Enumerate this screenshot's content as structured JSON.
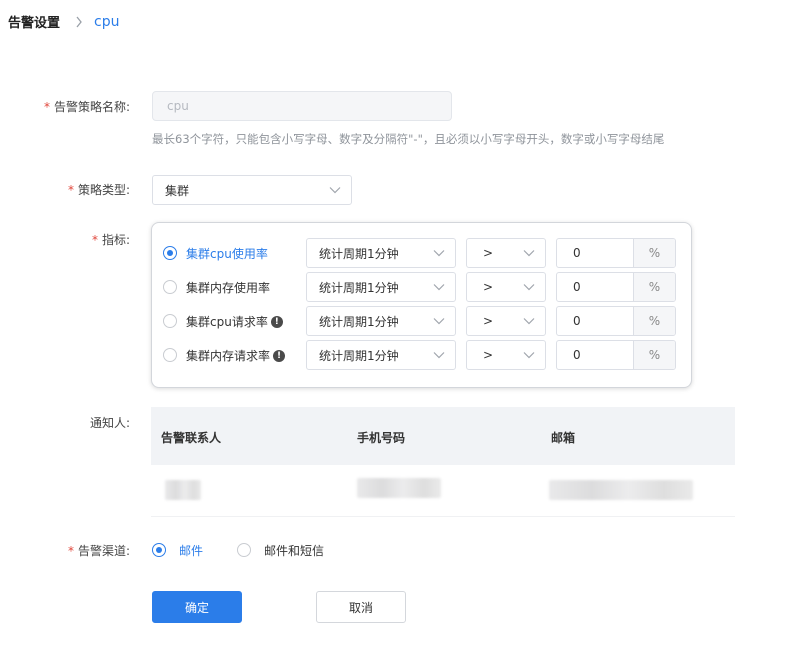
{
  "breadcrumb": {
    "root": "告警设置",
    "current": "cpu"
  },
  "form": {
    "name": {
      "label": "告警策略名称:",
      "value": "cpu",
      "hint": "最长63个字符，只能包含小写字母、数字及分隔符\"-\"，且必须以小写字母开头，数字或小写字母结尾"
    },
    "type": {
      "label": "策略类型:",
      "value": "集群"
    },
    "metrics": {
      "label": "指标:",
      "items": [
        {
          "name": "集群cpu使用率",
          "checked": true,
          "warn": false,
          "period": "统计周期1分钟",
          "op": ">",
          "value": "0",
          "unit": "%"
        },
        {
          "name": "集群内存使用率",
          "checked": false,
          "warn": false,
          "period": "统计周期1分钟",
          "op": ">",
          "value": "0",
          "unit": "%"
        },
        {
          "name": "集群cpu请求率",
          "checked": false,
          "warn": true,
          "period": "统计周期1分钟",
          "op": ">",
          "value": "0",
          "unit": "%"
        },
        {
          "name": "集群内存请求率",
          "checked": false,
          "warn": true,
          "period": "统计周期1分钟",
          "op": ">",
          "value": "0",
          "unit": "%"
        }
      ]
    },
    "notify": {
      "label": "通知人:",
      "columns": [
        "告警联系人",
        "手机号码",
        "邮箱"
      ]
    },
    "channel": {
      "label": "告警渠道:",
      "options": [
        "邮件",
        "邮件和短信"
      ],
      "selected": "邮件"
    }
  },
  "actions": {
    "confirm": "确定",
    "cancel": "取消"
  },
  "colors": {
    "primary": "#2b7de9",
    "required": "#e0463b"
  },
  "icons": {
    "breadcrumb_separator": "chevron-right-icon",
    "select": "chevron-down-icon",
    "warning": "exclamation-circle-icon"
  }
}
